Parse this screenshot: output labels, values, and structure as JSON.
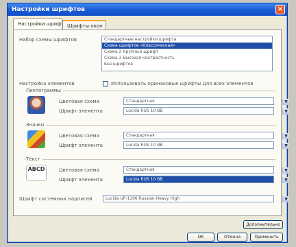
{
  "window": {
    "title": "Настройки шрифтов",
    "close_glyph": "×"
  },
  "tabs": [
    {
      "label": "Настройки шрифтов"
    },
    {
      "label": "Шрифты окон"
    }
  ],
  "scheme": {
    "label": "Набор схемы шрифтов",
    "items": [
      "Стандартные настройки шрифта",
      "Схема шрифтов «Классическая»",
      "Схема 2 Крупный шрифт",
      "Схема 3 Высокая контрастность",
      "Без шрифтов"
    ],
    "selected_index": 1
  },
  "all_elements": {
    "label": "Настройка элементов",
    "checkbox_label": "Использовать одинаковые шрифты для всех элементов",
    "checked": false
  },
  "groups": [
    {
      "title": "Пиктограммы",
      "icon": "user-portrait-icon",
      "rows": [
        {
          "label": "Цветовая схема",
          "value": "Стандартная"
        },
        {
          "label": "Шрифт элемента",
          "value": "Lucida RUS 10 BB"
        }
      ]
    },
    {
      "title": "Значки",
      "icon": "desktop-icons-icon",
      "rows": [
        {
          "label": "Цветовая схема",
          "value": "Стандартная"
        },
        {
          "label": "Шрифт элемента",
          "value": "Lucida RUS 10 BB"
        }
      ]
    },
    {
      "title": "Текст",
      "icon": "text-sample-icon",
      "icon_text": "ABCD",
      "rows": [
        {
          "label": "Цветовая схема",
          "value": "Стандартная"
        },
        {
          "label": "Шрифт элемента",
          "value": "Lucida RUS 10 BB",
          "highlighted": true
        }
      ]
    }
  ],
  "system_font": {
    "label": "Шрифт системных надписей",
    "value": "Lucida UP-1106 Russian Heavy High"
  },
  "buttons": {
    "advanced": "Дополнительно",
    "ok": "OK",
    "cancel": "Отмена",
    "apply": "Применить"
  },
  "colors": {
    "titlebar": "#1d5fd8",
    "selection": "#1e4ea8",
    "tab_accent": "#f6a630"
  }
}
